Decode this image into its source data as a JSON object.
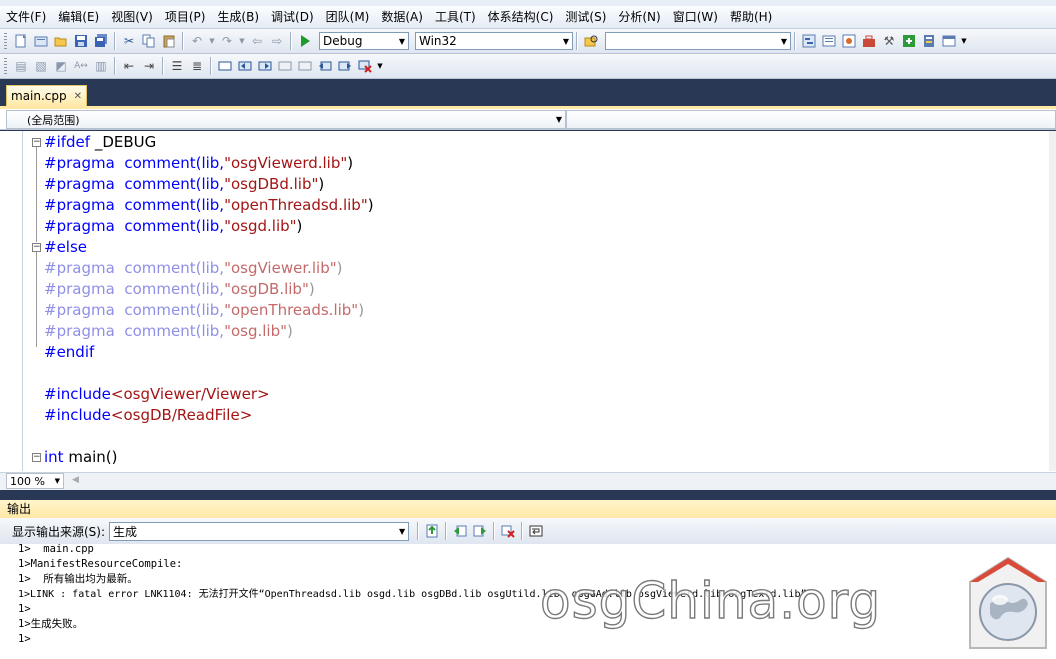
{
  "menubar": {
    "items": [
      "文件(F)",
      "编辑(E)",
      "视图(V)",
      "项目(P)",
      "生成(B)",
      "调试(D)",
      "团队(M)",
      "数据(A)",
      "工具(T)",
      "体系结构(C)",
      "测试(S)",
      "分析(N)",
      "窗口(W)",
      "帮助(H)"
    ]
  },
  "toolbar": {
    "config_value": "Debug",
    "platform_value": "Win32",
    "find_value": ""
  },
  "editor": {
    "tab_label": "main.cpp",
    "tab_close": "✕",
    "scope_label": "(全局范围)",
    "zoom": "100 %",
    "lines": [
      {
        "kw": "#ifdef",
        "rest": " _DEBUG"
      },
      {
        "kw": "#pragma",
        "fn": "comment(lib,",
        "str": "\"osgViewerd.lib\"",
        "end": ")"
      },
      {
        "kw": "#pragma",
        "fn": "comment(lib,",
        "str": "\"osgDBd.lib\"",
        "end": ")"
      },
      {
        "kw": "#pragma",
        "fn": "comment(lib,",
        "str": "\"openThreadsd.lib\"",
        "end": ")"
      },
      {
        "kw": "#pragma",
        "fn": "comment(lib,",
        "str": "\"osgd.lib\"",
        "end": ")"
      },
      {
        "kw": "#else"
      },
      {
        "kw": "#pragma",
        "fn": "comment(lib,",
        "str": "\"osgViewer.lib\"",
        "end": ")"
      },
      {
        "kw": "#pragma",
        "fn": "comment(lib,",
        "str": "\"osgDB.lib\"",
        "end": ")"
      },
      {
        "kw": "#pragma",
        "fn": "comment(lib,",
        "str": "\"openThreads.lib\"",
        "end": ")"
      },
      {
        "kw": "#pragma",
        "fn": "comment(lib,",
        "str": "\"osg.lib\"",
        "end": ")"
      },
      {
        "kw": "#endif"
      },
      {
        "kw": "#include",
        "str": "<osgViewer/Viewer>"
      },
      {
        "kw": "#include",
        "str": "<osgDB/ReadFile>"
      },
      {
        "kw": "int",
        "rest": " main()"
      }
    ]
  },
  "output": {
    "title": "输出",
    "source_label": "显示输出来源(S):",
    "source_value": "生成",
    "lines": [
      "1>  main.cpp",
      "1>ManifestResourceCompile:",
      "1>  所有输出均为最新。",
      "1>LINK : fatal error LNK1104: 无法打开文件“OpenThreadsd.lib osgd.lib osgDBd.lib osgUtild.lib  osgGAd.lib osgViewerd.lib osgTextd.lib”",
      "1>",
      "1>生成失败。",
      "1>"
    ]
  },
  "watermark": "osgChina.org",
  "colors": {
    "keyword": "#0000ff",
    "string": "#a31515",
    "inactive_keyword": "#8f8fe8",
    "inactive_string": "#c46a6a",
    "chrome": "#293955",
    "tab_active": "#ffe8a6"
  }
}
